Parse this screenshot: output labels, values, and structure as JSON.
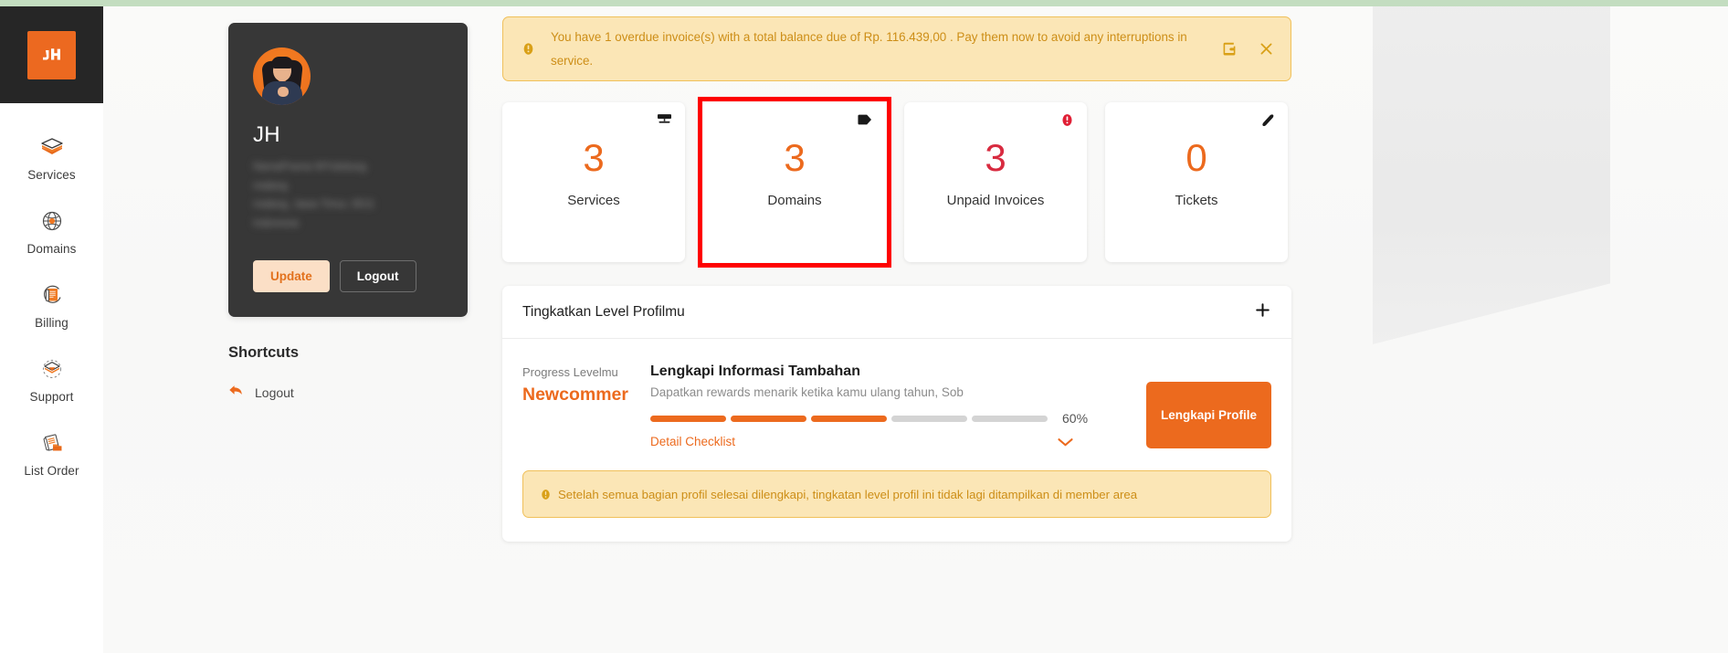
{
  "app": {
    "logo_icon": "jagoan-hosting-logo-icon",
    "accent_color": "#ec6a1e",
    "danger_color": "#d82b40",
    "warning_bg": "#fbe6b6",
    "warning_text_color": "#cd8e17",
    "highlight_color": "#fe0000"
  },
  "sidebar": {
    "items": [
      {
        "label": "Services",
        "icon": "services-box-icon"
      },
      {
        "label": "Domains",
        "icon": "domains-globe-icon"
      },
      {
        "label": "Billing",
        "icon": "billing-document-icon"
      },
      {
        "label": "Support",
        "icon": "support-inbox-icon"
      },
      {
        "label": "List Order",
        "icon": "list-order-icon"
      }
    ]
  },
  "profile": {
    "avatar_icon": "user-avatar",
    "initials": "JH",
    "address_lines": [
      "NamaPrama WYubdueg",
      "malang",
      "malang, Jawa Timur, 6511",
      "Indonesia"
    ],
    "update_label": "Update",
    "logout_label": "Logout"
  },
  "shortcuts": {
    "title": "Shortcuts",
    "items": [
      {
        "label": "Logout",
        "icon": "logout-arrow-icon"
      }
    ]
  },
  "alert": {
    "icon": "exclamation-circle-icon",
    "message": "You have 1 overdue invoice(s) with a total balance due of Rp. 116.439,00 . Pay them now to avoid any interruptions in service.",
    "pay_icon": "wallet-icon",
    "close_icon": "close-icon"
  },
  "stats": [
    {
      "value": "3",
      "label": "Services",
      "icon": "server-icon",
      "color": "#ec6a1e",
      "highlighted": false
    },
    {
      "value": "3",
      "label": "Domains",
      "icon": "tag-icon",
      "color": "#ec6a1e",
      "highlighted": true
    },
    {
      "value": "3",
      "label": "Unpaid Invoices",
      "icon": "alert-circle-icon",
      "color": "#d82b40",
      "highlighted": false
    },
    {
      "value": "0",
      "label": "Tickets",
      "icon": "ticket-tag-icon",
      "color": "#ec6a1e",
      "highlighted": false
    }
  ],
  "level_panel": {
    "header_title": "Tingkatkan Level Profilmu",
    "expand_icon": "plus-icon",
    "progress_caption": "Progress Levelmu",
    "progress_level": "Newcommer",
    "task_title": "Lengkapi Informasi Tambahan",
    "task_subtitle": "Dapatkan rewards menarik ketika kamu ulang tahun, Sob",
    "progress_percent_label": "60%",
    "progress_segments_total": 5,
    "progress_segments_filled": 3,
    "detail_checklist_label": "Detail Checklist",
    "chevron_icon": "chevron-down-icon",
    "cta_label": "Lengkapi Profile",
    "notice_icon": "exclamation-circle-icon",
    "notice_text": "Setelah semua bagian profil selesai dilengkapi, tingkatan level profil ini tidak lagi ditampilkan di member area"
  }
}
